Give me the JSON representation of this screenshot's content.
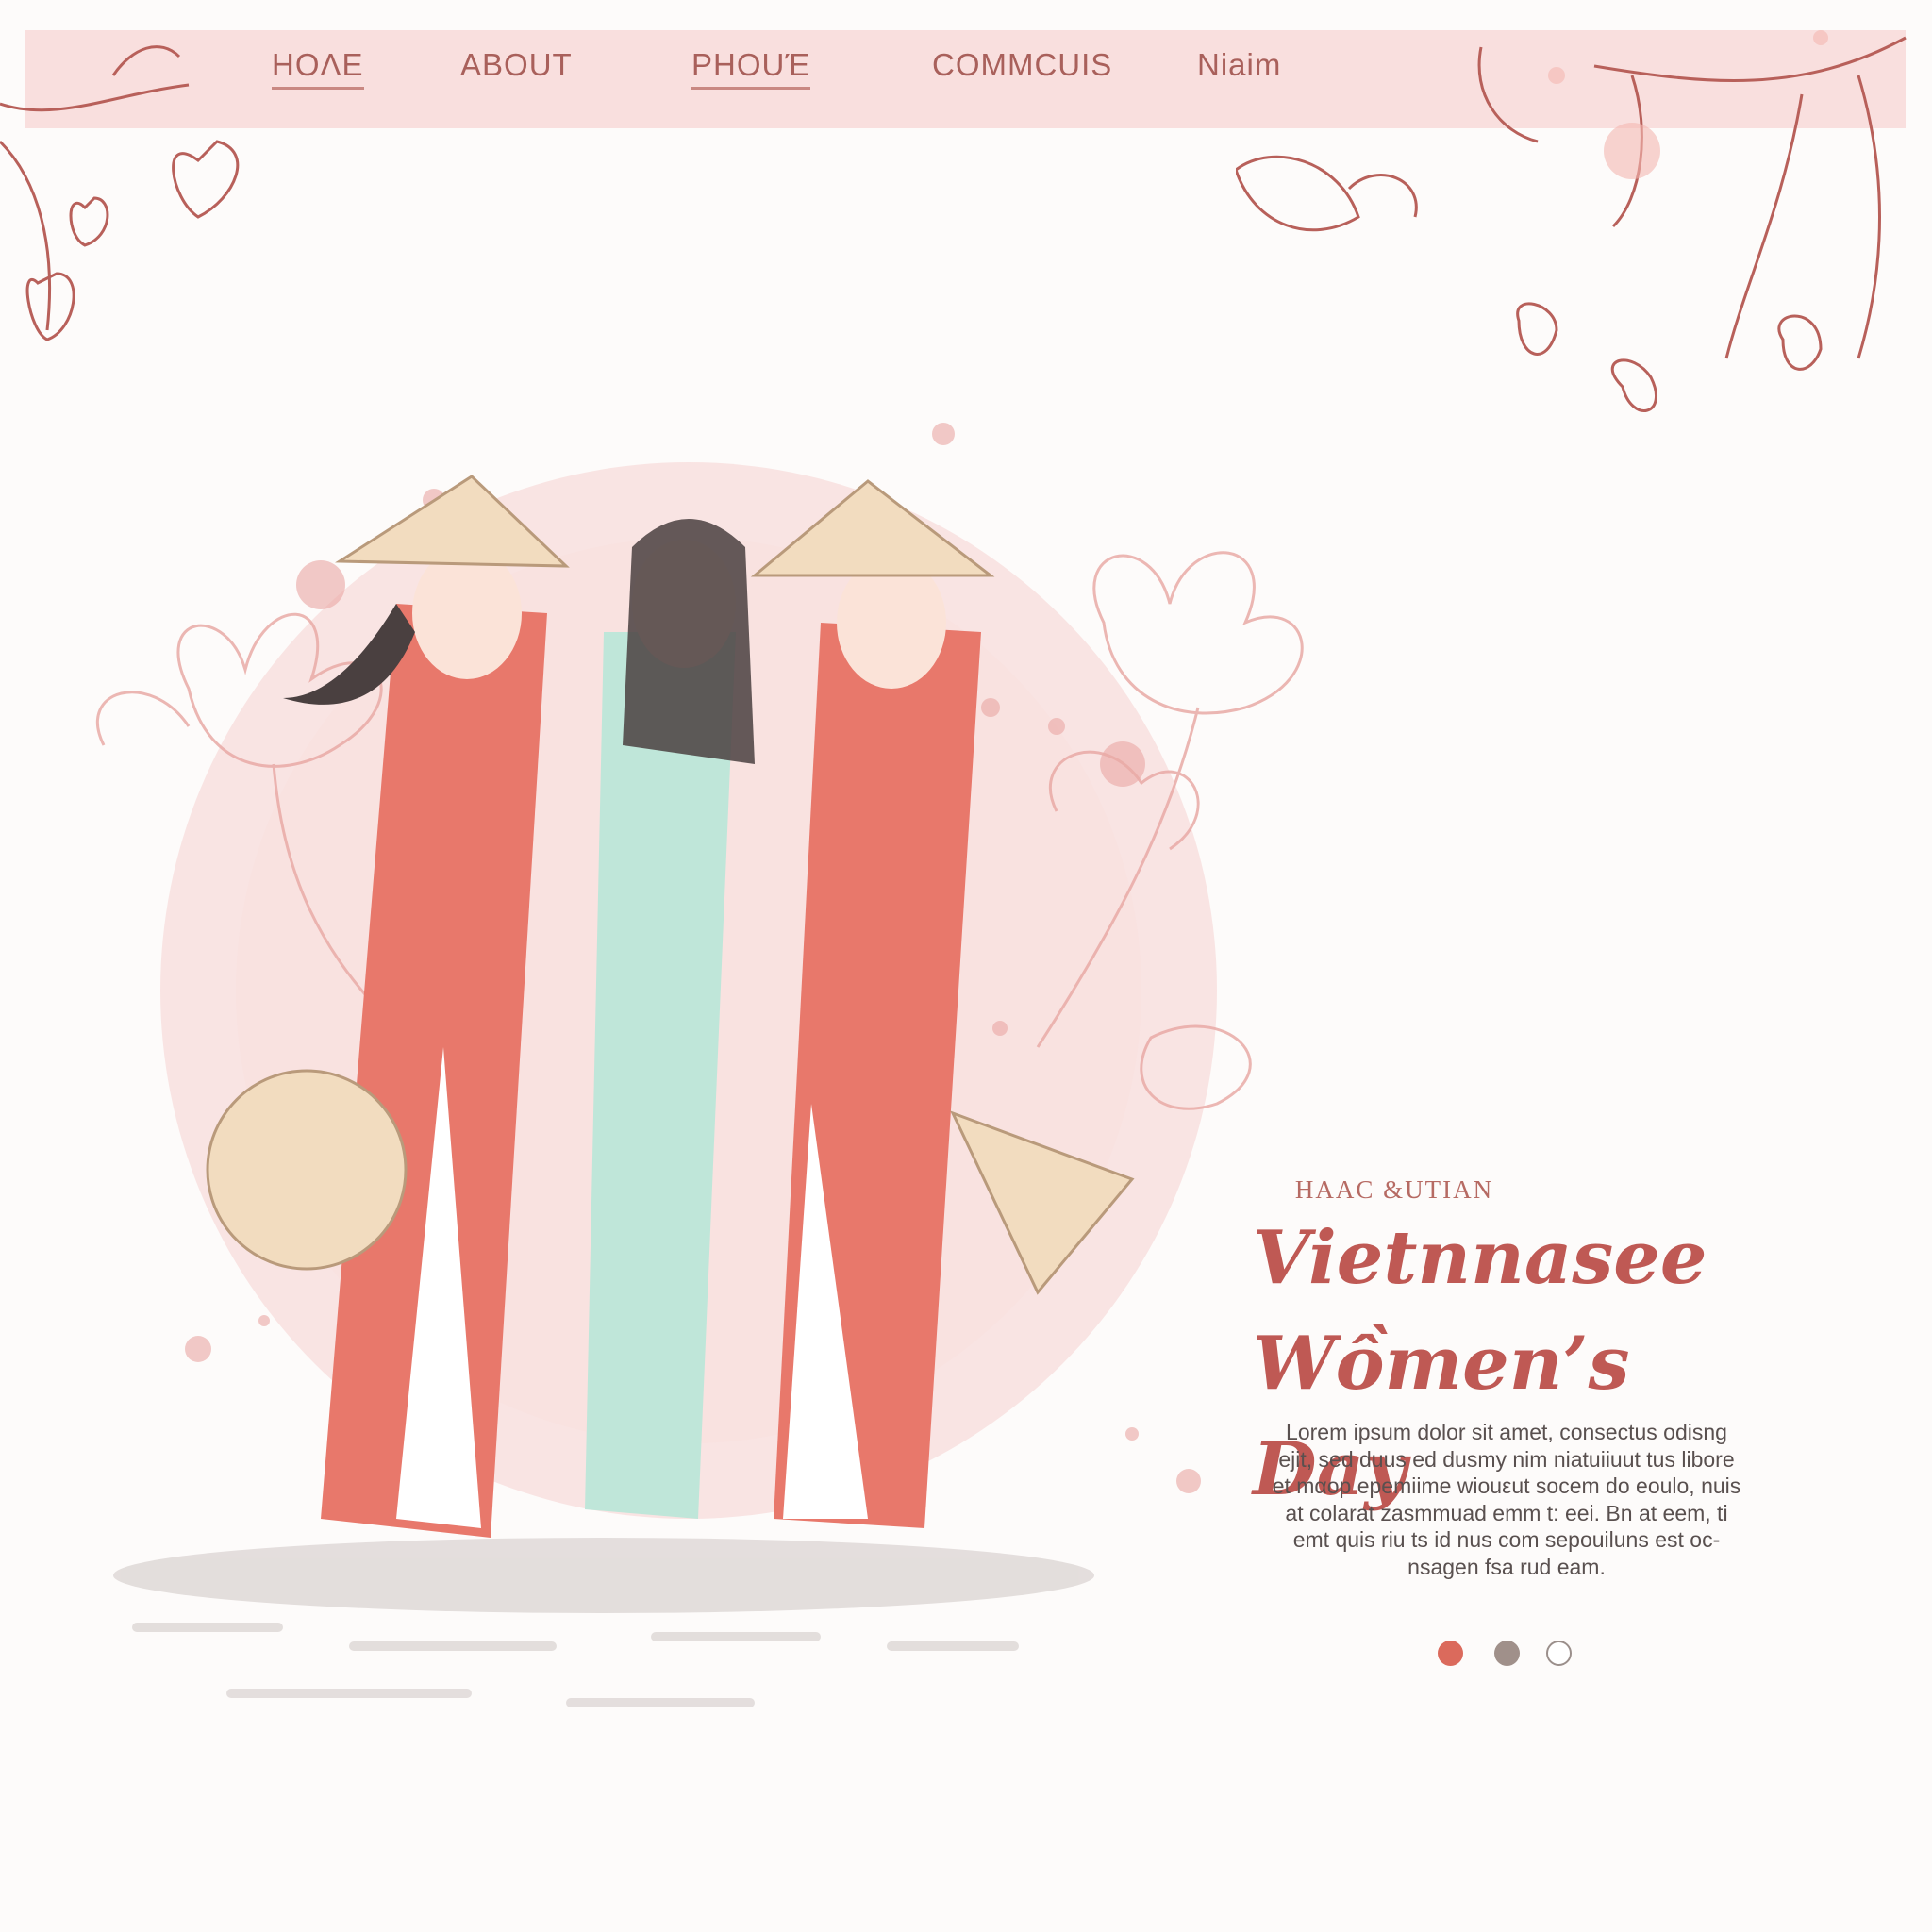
{
  "nav": {
    "items": [
      {
        "label": "HOΛE"
      },
      {
        "label": "ABOUT"
      },
      {
        "label": "PHOUΈ"
      },
      {
        "label": "COMMCUIS"
      },
      {
        "label": "Niaim"
      }
    ]
  },
  "hero": {
    "eyebrow": "HAAC &UTIAN",
    "headline_line1": "Vietnnasee",
    "headline_line2": "Wồmen’s Day",
    "body": "Lorem ipsum dolor sit amet, consectus odisng ejit, sed duus ed dusmy nim niatuiiuut tus libore et mαop epemiime wiouεut socem do eoulo, nuis at colarat zasmmuad emm t: eei. Bn at eem, ti emt quis riu ts id nus com sepouiluns est oc- nsagen fsa rud eam.",
    "carousel": {
      "active_index": 0,
      "count": 3
    }
  },
  "colors": {
    "accent": "#bf5954",
    "navbar_bg": "#f9dcdb",
    "ao_dai_red": "#e8786b",
    "ao_dai_mint": "#bfe6d9",
    "hat": "#f2dcbf",
    "line_art": "#b8605a"
  },
  "icons": [
    "lotus-flower-icon",
    "cherry-branch-icon",
    "conical-hat-icon"
  ]
}
